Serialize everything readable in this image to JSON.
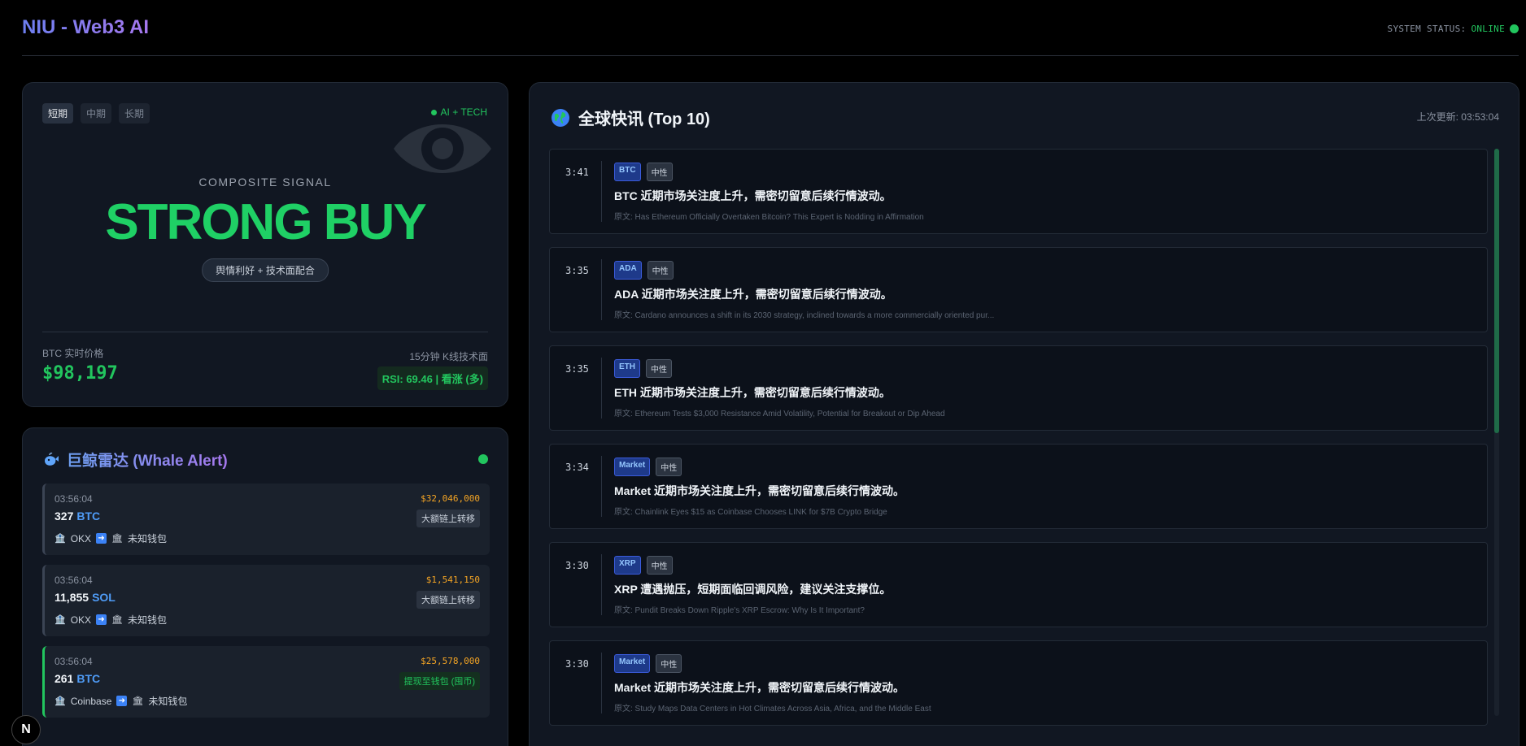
{
  "header": {
    "brand": "NIU - Web3 AI",
    "status_label": "SYSTEM STATUS:",
    "status_value": "ONLINE"
  },
  "signal": {
    "tabs": [
      "短期",
      "中期",
      "长期"
    ],
    "active_tab": "短期",
    "ai_tag": "AI + TECH",
    "composite_label": "COMPOSITE SIGNAL",
    "signal": "STRONG BUY",
    "reason": "舆情利好 + 技术面配合",
    "price_label": "BTC 实时价格",
    "price": "$98,197",
    "kline_label": "15分钟 K线技术面",
    "rsi": "RSI: 69.46 | 看涨 (多)",
    "colors": {
      "accent": "#22c55e"
    }
  },
  "whale": {
    "title": "巨鲸雷达 (Whale Alert)",
    "items": [
      {
        "time": "03:56:04",
        "usd": "$32,046,000",
        "amount": "327",
        "symbol": "BTC",
        "type": "大额链上转移",
        "from": "OKX",
        "to": "未知钱包",
        "kind": "transfer"
      },
      {
        "time": "03:56:04",
        "usd": "$1,541,150",
        "amount": "11,855",
        "symbol": "SOL",
        "type": "大额链上转移",
        "from": "OKX",
        "to": "未知钱包",
        "kind": "transfer"
      },
      {
        "time": "03:56:04",
        "usd": "$25,578,000",
        "amount": "261",
        "symbol": "BTC",
        "type": "提现至钱包 (囤币)",
        "from": "Coinbase",
        "to": "未知钱包",
        "kind": "withdraw"
      }
    ]
  },
  "news": {
    "title": "全球快讯 (Top 10)",
    "updated": "上次更新: 03:53:04",
    "items": [
      {
        "time": "3:41",
        "symbol": "BTC",
        "sentiment": "中性",
        "headline": "BTC 近期市场关注度上升，需密切留意后续行情波动。",
        "source": "原文: Has Ethereum Officially Overtaken Bitcoin? This Expert is Nodding in Affirmation"
      },
      {
        "time": "3:35",
        "symbol": "ADA",
        "sentiment": "中性",
        "headline": "ADA 近期市场关注度上升，需密切留意后续行情波动。",
        "source": "原文: Cardano announces a shift in its 2030 strategy, inclined towards a more commercially oriented pur..."
      },
      {
        "time": "3:35",
        "symbol": "ETH",
        "sentiment": "中性",
        "headline": "ETH 近期市场关注度上升，需密切留意后续行情波动。",
        "source": "原文: Ethereum Tests $3,000 Resistance Amid Volatility, Potential for Breakout or Dip Ahead"
      },
      {
        "time": "3:34",
        "symbol": "Market",
        "sentiment": "中性",
        "headline": "Market 近期市场关注度上升，需密切留意后续行情波动。",
        "source": "原文: Chainlink Eyes $15 as Coinbase Chooses LINK for $7B Crypto Bridge"
      },
      {
        "time": "3:30",
        "symbol": "XRP",
        "sentiment": "中性",
        "headline": "XRP 遭遇抛压，短期面临回调风险，建议关注支撑位。",
        "source": "原文: Pundit Breaks Down Ripple's XRP Escrow: Why Is It Important?"
      },
      {
        "time": "3:30",
        "symbol": "Market",
        "sentiment": "中性",
        "headline": "Market 近期市场关注度上升，需密切留意后续行情波动。",
        "source": "原文: Study Maps Data Centers in Hot Climates Across Asia, Africa, and the Middle East"
      }
    ]
  },
  "badge": {
    "label": "N"
  }
}
